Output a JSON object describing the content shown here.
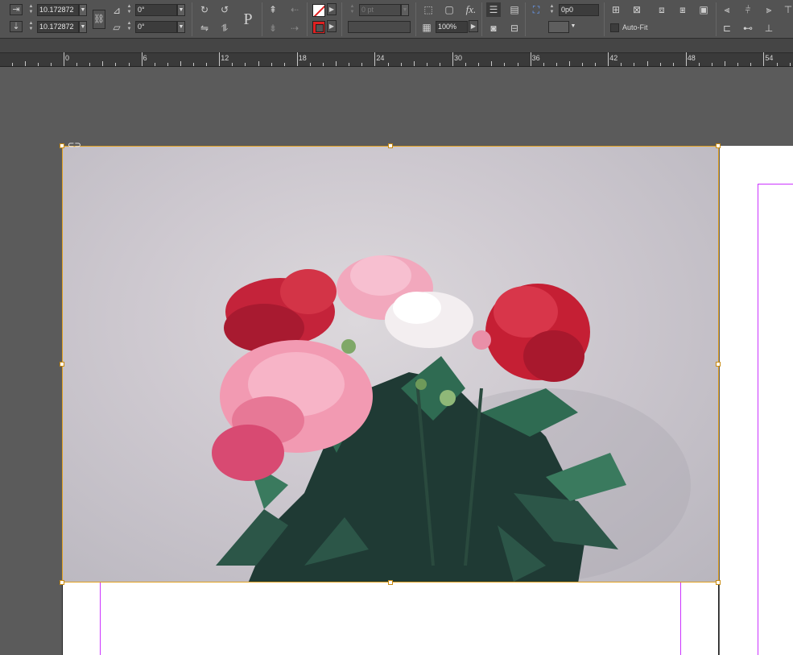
{
  "control_panel": {
    "x_offset": "10.172872",
    "y_offset": "10.172872",
    "angle": "0°",
    "shear": "0°",
    "stroke_weight": "0 pt",
    "opacity": "100%",
    "inset_value": "0p0",
    "auto_fit_label": "Auto-Fit",
    "effects_label": "fx.",
    "type_glyph": "P"
  },
  "ruler": {
    "labels": [
      "0",
      "6",
      "12",
      "18",
      "24",
      "30",
      "36",
      "42",
      "48",
      "54"
    ]
  },
  "image": {
    "description_icon": "flower-bouquet-image",
    "colors": {
      "frame_border": "#e0a020",
      "margin_guide": "#cc33ff"
    }
  }
}
